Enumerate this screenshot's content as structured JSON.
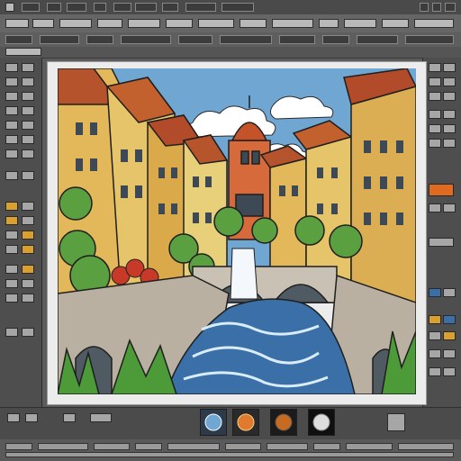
{
  "canvas": {
    "title": "",
    "zoom": ""
  },
  "colors": {
    "chrome": "#5c5c5c",
    "accent": "#d9a030",
    "canvas_bg": "#ececec"
  },
  "thumbnails": [
    {
      "icon": "blue-sphere-icon"
    },
    {
      "icon": "orange-sphere-icon"
    },
    {
      "icon": "dark-sphere-icon"
    },
    {
      "icon": "black-sphere-icon"
    }
  ]
}
